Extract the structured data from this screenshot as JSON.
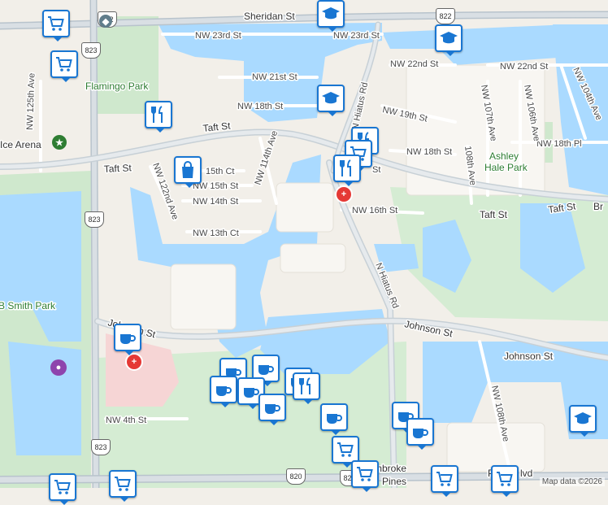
{
  "streets": {
    "sheridan": "Sheridan St",
    "nw23": "NW 23rd St",
    "nw22_left": "NW 22nd St",
    "nw22_right": "NW 22nd St",
    "nw21": "NW 21st St",
    "nw18_left": "NW 18th St",
    "nw19": "NW 19th St",
    "nw18_right": "NW 18th St",
    "nw18pl": "NW 18th Pl",
    "taft_left": "Taft St",
    "taft_center": "Taft St",
    "taft_bottom_left": "Taft St",
    "taft_right1": "Taft St",
    "taft_right2": "Taft St",
    "br": "Br",
    "nw15ct": "15th Ct",
    "nw15": "NW 15th St",
    "nw14": "NW 14th St",
    "nw13": "NW 13th Ct",
    "nw16": "NW 16th St",
    "nw114": "NW 114th Ave",
    "nw122": "NW 122nd Ave",
    "nw125": "NW 125th Ave",
    "hiatus_top": "N Hiatus Rd",
    "hiatus_bottom": "N Hiatus Rd",
    "hiatus_st": "St",
    "nw107": "NW 107th Ave",
    "nw106": "NW 106th Ave",
    "nw104": "NW 104th Ave",
    "nw108_upper": "108th Ave",
    "nw108_lower": "NW 108th Ave",
    "johnson_left": "Johnson St",
    "johnson_center": "Johnson St",
    "johnson_right": "Johnson St",
    "nw4": "NW 4th St",
    "pines_blvd": "P",
    "blvd": "lvd",
    "pines_top": "mbroke",
    "pines_bottom": "Pines"
  },
  "places": {
    "flamingo_park": "Flamingo Park",
    "ice_arena": "Ice Arena",
    "ashley_hale_park_1": "Ashley",
    "ashley_hale_park_2": "Hale Park",
    "smith_park": "B Smith Park"
  },
  "shields": {
    "s822_top": "822",
    "s822_right": "822",
    "s823_top": "823",
    "s823_mid": "823",
    "s823_bottom": "823",
    "s820": "820",
    "s820b": "820"
  },
  "attribution": "Map data ©2026",
  "pins": [
    {
      "icon": "cart-icon"
    },
    {
      "icon": "cart-icon"
    },
    {
      "icon": "restaurant-icon"
    },
    {
      "icon": "school-icon"
    },
    {
      "icon": "school-icon"
    },
    {
      "icon": "shopping-bag-icon"
    },
    {
      "icon": "restaurant-icon"
    },
    {
      "icon": "coffee-icon"
    },
    {
      "icon": "coffee-icon"
    },
    {
      "icon": "cart-icon"
    },
    {
      "icon": "school-icon"
    }
  ],
  "colors": {
    "water": "#aadaff",
    "park": "#c8e6c9",
    "road_major": "#b0bec5",
    "pin_border": "#1976d2"
  }
}
